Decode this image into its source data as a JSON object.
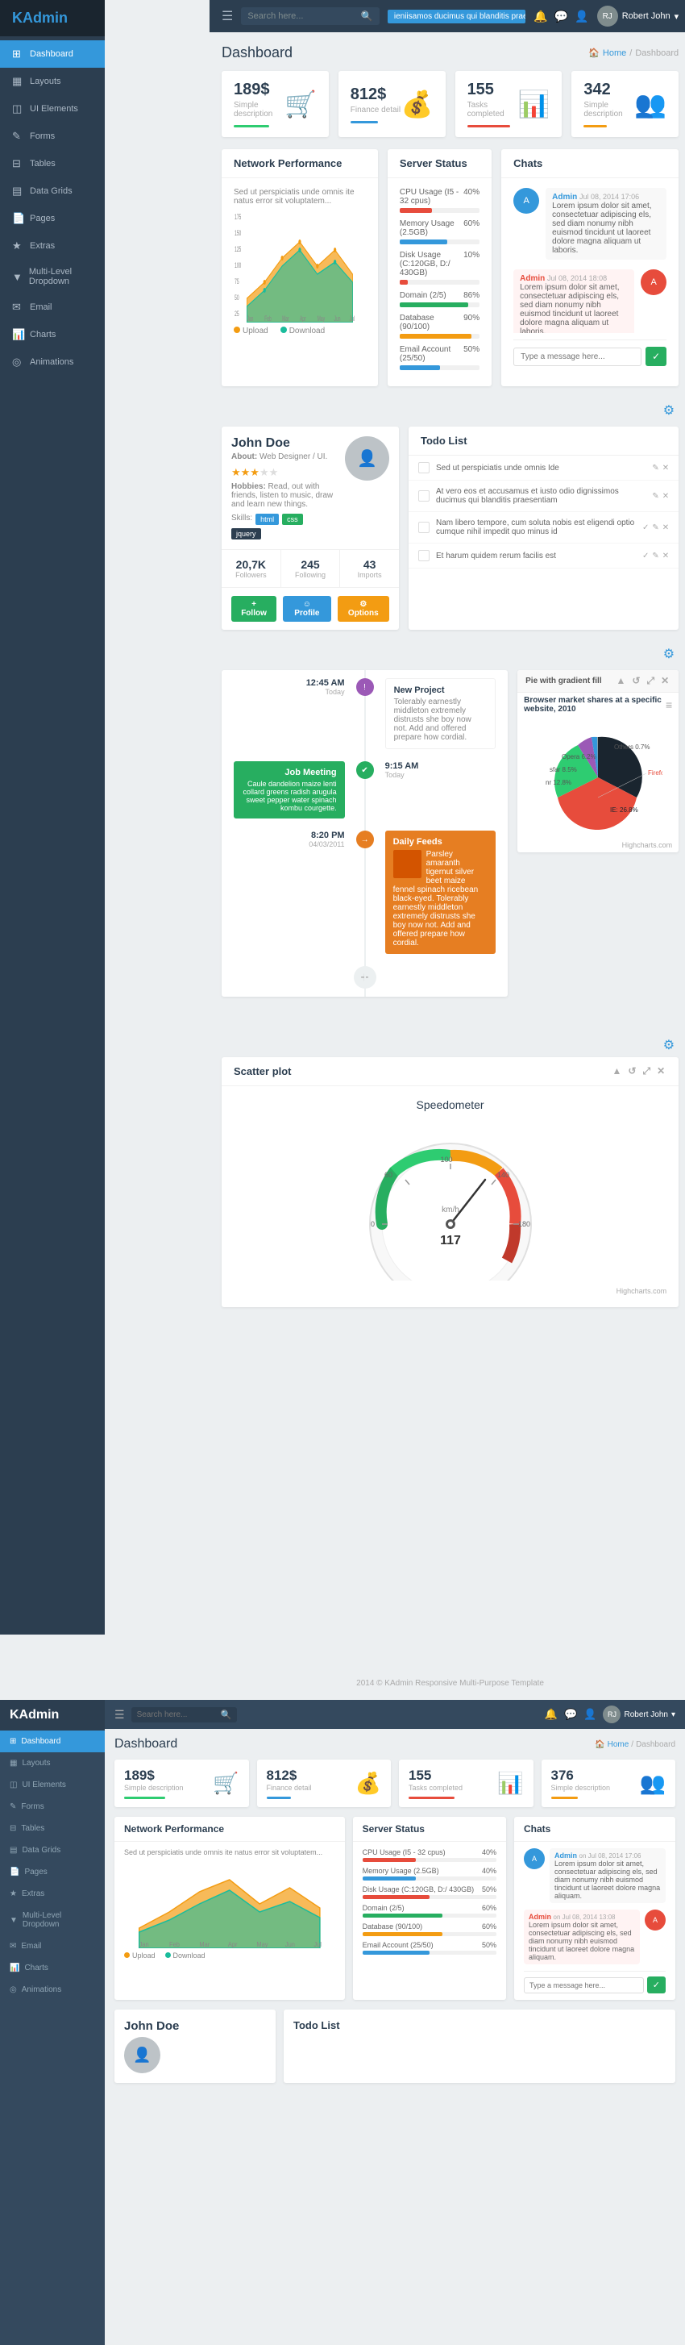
{
  "app": {
    "name": "KAdmin",
    "logo_icon": "K"
  },
  "topbar": {
    "menu_icon": "☰",
    "search_placeholder": "Search here...",
    "marquee_text": "ieniisamos ducimus qui blanditis praesontium voluptatem delondi atque.",
    "user_name": "Robert John",
    "bell_icon": "🔔",
    "chat_icon": "💬",
    "user_icon": "👤"
  },
  "sidebar": {
    "items": [
      {
        "label": "Dashboard",
        "icon": "⊞",
        "active": true
      },
      {
        "label": "Layouts",
        "icon": "▦"
      },
      {
        "label": "UI Elements",
        "icon": "◫"
      },
      {
        "label": "Forms",
        "icon": "✎"
      },
      {
        "label": "Tables",
        "icon": "⊟"
      },
      {
        "label": "Data Grids",
        "icon": "▤"
      },
      {
        "label": "Pages",
        "icon": "📄"
      },
      {
        "label": "Extras",
        "icon": "★"
      },
      {
        "label": "Multi-Level Dropdown",
        "icon": "▼"
      },
      {
        "label": "Email",
        "icon": "✉"
      },
      {
        "label": "Charts",
        "icon": "📊"
      },
      {
        "label": "Animations",
        "icon": "◎"
      }
    ]
  },
  "breadcrumb": {
    "page_title": "Dashboard",
    "home_label": "Home",
    "current_label": "Dashboard"
  },
  "stat_cards": [
    {
      "value": "189$",
      "label": "Simple description",
      "bar_width": "70",
      "bar_color": "bar-green",
      "icon": "🛒"
    },
    {
      "value": "812$",
      "label": "Finance detail",
      "bar_width": "55",
      "bar_color": "bar-blue",
      "icon": "💰"
    },
    {
      "value": "155",
      "label": "Tasks completed",
      "bar_width": "85",
      "bar_color": "bar-red",
      "icon": "📊"
    },
    {
      "value": "342",
      "label": "Simple description",
      "bar_width": "45",
      "bar_color": "bar-orange",
      "icon": "👥"
    }
  ],
  "network_performance": {
    "title": "Network Performance",
    "subtitle": "Sed ut perspiciatis unde omnis ite natus error sit voluptatem...",
    "legend": [
      {
        "label": "Upload",
        "color": "#f39c12"
      },
      {
        "label": "Download",
        "color": "#1abc9c"
      }
    ],
    "x_labels": [
      "Jan",
      "Feb",
      "Mar",
      "Apr",
      "May",
      "Jun",
      "Jul"
    ],
    "y_labels": [
      "175",
      "150",
      "125",
      "100",
      "75",
      "50",
      "25"
    ]
  },
  "server_status": {
    "title": "Server Status",
    "items": [
      {
        "label": "CPU Usage (I5 - 32 cpus)",
        "percent": 40,
        "color": "#e74c3c"
      },
      {
        "label": "Memory Usage (2.5GB)",
        "percent": 60,
        "color": "#3498db"
      },
      {
        "label": "Disk Usage (C:120GB, D:/ 430GB)",
        "percent": 10,
        "color": "#e74c3c"
      },
      {
        "label": "Domain (2/5)",
        "percent": 86,
        "color": "#27ae60"
      },
      {
        "label": "Database (90/100)",
        "percent": 90,
        "color": "#f39c12"
      },
      {
        "label": "Email Account (25/50)",
        "percent": 50,
        "color": "#3498db"
      }
    ]
  },
  "chats": {
    "title": "Chats",
    "messages": [
      {
        "user": "Admin",
        "date": "Jul 08, 2014 17:06",
        "text": "Lorem ipsum dolor sit amet, consectetuar adipiscing els, sed diam nonumy nibh euismod tincidunt ut laoreet dolore magna aliquam ut laboris.",
        "avatar_color": "#3498db",
        "align": "left"
      },
      {
        "user": "Admin",
        "date": "Jul 08, 2014 18:08",
        "text": "Lorem ipsum dolor sit amet, consectetuar adipiscing els, sed diam nonumy nibh euismod tincidunt ut laoreet dolore magna aliquam ut laboris.",
        "avatar_color": "#e74c3c",
        "align": "right"
      }
    ],
    "input_placeholder": "Type a message here..."
  },
  "profile": {
    "name": "John Doe",
    "about_label": "About:",
    "about_value": "Web Designer / UI.",
    "hobbies_label": "Hobbies:",
    "hobbies_value": "Read, out with friends, listen to music, draw and learn new things.",
    "skills_label": "Skills:",
    "skills": [
      "html",
      "css",
      "jquery"
    ],
    "stats": [
      {
        "value": "20,7K",
        "label": "Followers"
      },
      {
        "value": "245",
        "label": "Following"
      },
      {
        "value": "43",
        "label": "Imports"
      }
    ],
    "buttons": [
      {
        "label": "+ Follow",
        "style": "btn-green"
      },
      {
        "label": "☺ Profile",
        "style": "btn-blue"
      },
      {
        "label": "⚙ Options",
        "style": "btn-orange"
      }
    ],
    "rating": 3.5
  },
  "todo": {
    "title": "Todo List",
    "items": [
      {
        "text": "Sed ut perspiciatis unde omnis Ide",
        "done": false
      },
      {
        "text": "At vero eos et accusamus et iusto odio dignissimos ducimus qui blanditis praesentiam",
        "done": false
      },
      {
        "text": "Nam libero tempore, cum soluta nobis est eligendi optio cumque nihil impedit quo minus id",
        "done": false
      },
      {
        "text": "Et harum quidem rerum facilis est",
        "done": false
      }
    ]
  },
  "timeline": {
    "items": [
      {
        "time": "12:45 AM",
        "date": "Today",
        "side": "right",
        "color": "#9b59b6",
        "icon": "!",
        "title": "New Project",
        "text": "Tolerably earnestly middleton extremely distrusts she boy now not. Add and offered prepare how cordial."
      },
      {
        "time": "9:15 AM",
        "date": "Today",
        "side": "right",
        "color": "#27ae60",
        "icon": "✔",
        "title": "",
        "text": ""
      },
      {
        "time": "8:20 PM",
        "date": "04/03/2011",
        "side": "left",
        "color": "#e67e22",
        "icon": "→",
        "title": "Daily Feeds",
        "text": "Parsley amaranth tigernut silver beet maize fennel spinach ricebean black-eyed. Tolerably earnestly middleton extremely distrusts she boy now not. Add and offered prepare how cordial."
      }
    ],
    "job_meeting": {
      "title": "Job Meeting",
      "text": "Caule dandelion maize lenti collard greens radish arugula sweet pepper water spinach kombu courgette."
    }
  },
  "pie_chart": {
    "title": "Pie with gradient fill",
    "subtitle": "Browser market shares at a specific website, 2010",
    "segments": [
      {
        "label": "Others",
        "percent": 0.7,
        "color": "#95a5a6"
      },
      {
        "label": "Opera",
        "percent": 6.2,
        "color": "#3498db"
      },
      {
        "label": "sfar",
        "percent": 8.5,
        "color": "#9b59b6"
      },
      {
        "label": "nr",
        "percent": 12.8,
        "color": "#2ecc71"
      },
      {
        "label": "Firefox",
        "percent": 45.0,
        "color": "#e74c3c"
      },
      {
        "label": "IE",
        "percent": 26.8,
        "color": "#1a252f"
      }
    ],
    "footer": "Highcharts.com"
  },
  "scatter": {
    "title": "Scatter plot",
    "chart_title": "Speedometer",
    "footer": "Highcharts.com",
    "value": 117,
    "unit": "km/h"
  },
  "footer": {
    "text": "2014 © KAdmin Responsive Multi-Purpose Template"
  },
  "stat_cards2": [
    {
      "value": "189$",
      "label": "Simple description",
      "bar_width": "70",
      "bar_color": "bar-green",
      "icon": "🛒"
    },
    {
      "value": "812$",
      "label": "Finance detail",
      "bar_width": "55",
      "bar_color": "bar-blue",
      "icon": "💰"
    },
    {
      "value": "155",
      "label": "Tasks completed",
      "bar_width": "85",
      "bar_color": "bar-red",
      "icon": "📊"
    },
    {
      "value": "376",
      "label": "Simple description",
      "bar_width": "45",
      "bar_color": "bar-orange",
      "icon": "👥"
    }
  ]
}
